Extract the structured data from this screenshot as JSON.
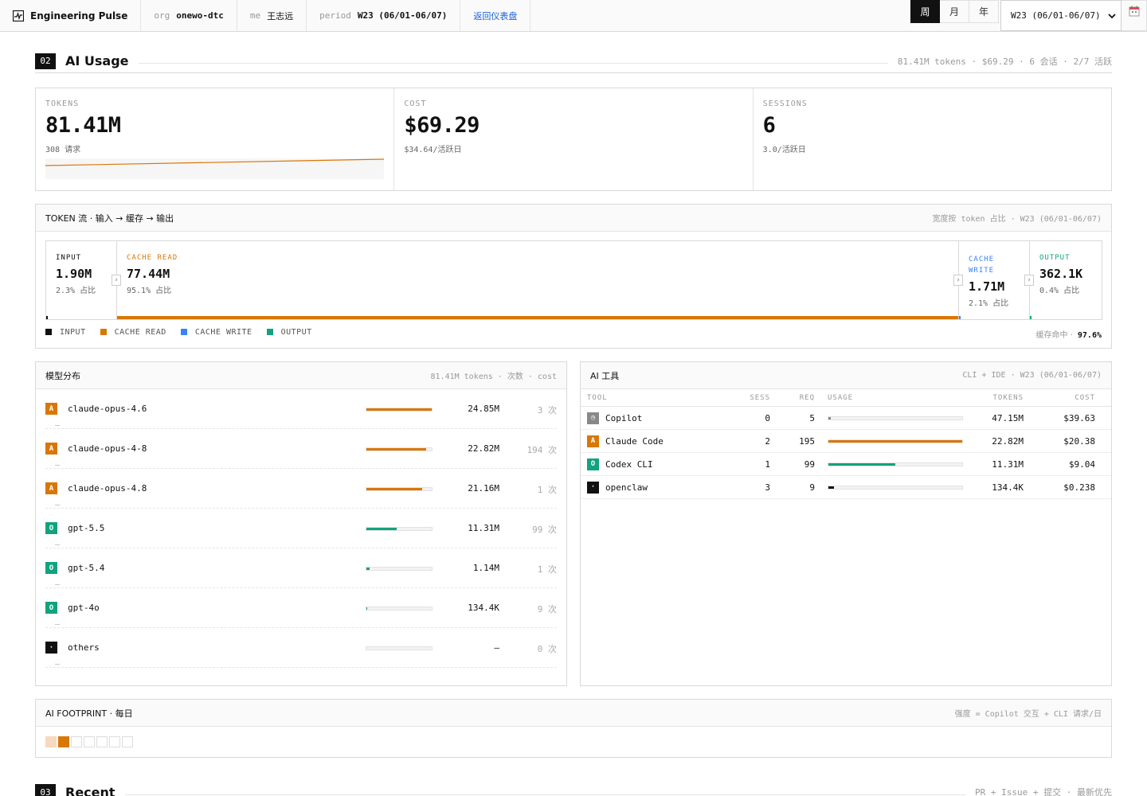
{
  "topbar": {
    "brand": "Engineering Pulse",
    "org_key": "org",
    "org_val": "onewo-dtc",
    "me_key": "me",
    "me_val": "王志远",
    "period_key": "period",
    "period_val": "W23 (06/01-06/07)",
    "back_link": "返回仪表盘",
    "seg": [
      "周",
      "月",
      "年"
    ],
    "seg_active": "周",
    "select_value": "W23 (06/01-06/07)"
  },
  "section_ai": {
    "num": "02",
    "title": "AI Usage",
    "meta": "81.41M tokens · $69.29 · 6 会话 · 2/7 活跃"
  },
  "kpis": {
    "tokens": {
      "label": "TOKENS",
      "value": "81.41M",
      "sub": "308 请求"
    },
    "cost": {
      "label": "COST",
      "value": "$69.29",
      "sub": "$34.64/活跃日"
    },
    "sessions": {
      "label": "SESSIONS",
      "value": "6",
      "sub": "3.0/活跃日"
    }
  },
  "token_flow": {
    "title": "TOKEN 流 · 输入 → 缓存 → 输出",
    "meta": "宽度按 token 占比 · W23 (06/01-06/07)",
    "segments": [
      {
        "label": "INPUT",
        "value": "1.90M",
        "share": "2.3% 占比",
        "color": "#111111"
      },
      {
        "label": "CACHE READ",
        "value": "77.44M",
        "share": "95.1% 占比",
        "color": "#d97706"
      },
      {
        "label": "CACHE WRITE",
        "value": "1.71M",
        "share": "2.1% 占比",
        "color": "#3b82f6"
      },
      {
        "label": "OUTPUT",
        "value": "362.1K",
        "share": "0.4% 占比",
        "color": "#10a37f"
      }
    ],
    "legend": [
      "INPUT",
      "CACHE READ",
      "CACHE WRITE",
      "OUTPUT"
    ],
    "hit_label": "缓存命中 ·",
    "hit_value": "97.6%"
  },
  "models": {
    "title": "模型分布",
    "meta": "81.41M tokens · 次数 · cost",
    "rows": [
      {
        "badge": "A",
        "color": "#d97706",
        "name": "claude-opus-4.6",
        "bar": 1.0,
        "value": "24.85M",
        "count": "3 次",
        "sub": "—"
      },
      {
        "badge": "A",
        "color": "#d97706",
        "name": "claude-opus-4-8",
        "bar": 0.92,
        "value": "22.82M",
        "count": "194 次",
        "sub": "—"
      },
      {
        "badge": "A",
        "color": "#d97706",
        "name": "claude-opus-4.8",
        "bar": 0.85,
        "value": "21.16M",
        "count": "1 次",
        "sub": "—"
      },
      {
        "badge": "O",
        "color": "#10a37f",
        "name": "gpt-5.5",
        "bar": 0.46,
        "value": "11.31M",
        "count": "99 次",
        "sub": "—"
      },
      {
        "badge": "O",
        "color": "#10a37f",
        "name": "gpt-5.4",
        "bar": 0.05,
        "value": "1.14M",
        "count": "1 次",
        "sub": "—"
      },
      {
        "badge": "O",
        "color": "#10a37f",
        "name": "gpt-4o",
        "bar": 0.01,
        "value": "134.4K",
        "count": "9 次",
        "sub": "—"
      },
      {
        "badge": "·",
        "color": "#111111",
        "name": "others",
        "bar": 0.0,
        "value": "—",
        "count": "0 次",
        "sub": "—"
      }
    ]
  },
  "tools": {
    "title": "AI 工具",
    "meta": "CLI + IDE · W23 (06/01-06/07)",
    "columns": [
      "TOOL",
      "SESS",
      "REQ",
      "USAGE",
      "TOKENS",
      "COST"
    ],
    "rows": [
      {
        "badge": "◷",
        "color": "#888888",
        "name": "Copilot",
        "sess": "0",
        "req": "5",
        "usage": 0.02,
        "usage_color": "#888888",
        "tokens": "47.15M",
        "cost": "$39.63"
      },
      {
        "badge": "A",
        "color": "#d97706",
        "name": "Claude Code",
        "sess": "2",
        "req": "195",
        "usage": 1.0,
        "usage_color": "#d97706",
        "tokens": "22.82M",
        "cost": "$20.38"
      },
      {
        "badge": "O",
        "color": "#10a37f",
        "name": "Codex CLI",
        "sess": "1",
        "req": "99",
        "usage": 0.5,
        "usage_color": "#10a37f",
        "tokens": "11.31M",
        "cost": "$9.04"
      },
      {
        "badge": "·",
        "color": "#111111",
        "name": "openclaw",
        "sess": "3",
        "req": "9",
        "usage": 0.04,
        "usage_color": "#111111",
        "tokens": "134.4K",
        "cost": "$0.238"
      }
    ]
  },
  "footprint": {
    "title": "AI FOOTPRINT · 每日",
    "meta": "强度 = Copilot 交互 + CLI 请求/日",
    "cells": [
      "#f6d9bf",
      "#d97706",
      "#ffffff",
      "#ffffff",
      "#ffffff",
      "#ffffff",
      "#ffffff"
    ]
  },
  "section_recent": {
    "num": "03",
    "title": "Recent",
    "meta": "PR + Issue + 提交 · 最新优先"
  }
}
